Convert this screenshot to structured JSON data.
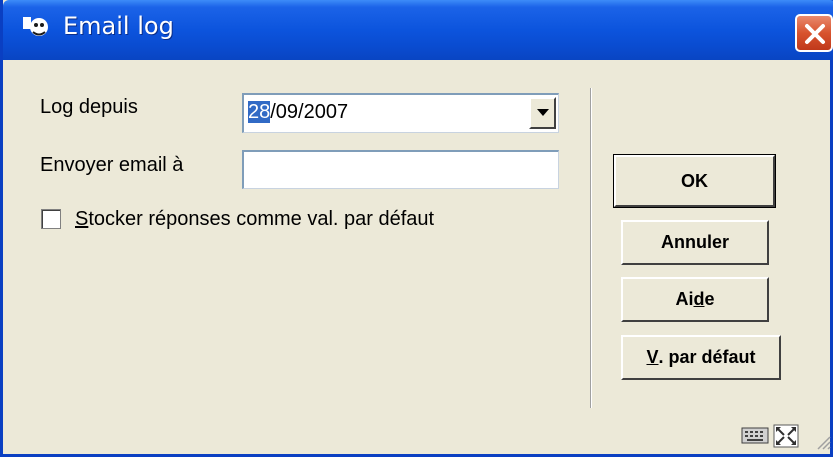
{
  "window": {
    "title": "Email log",
    "close_icon": "close-icon",
    "app_icon": "app-icon"
  },
  "form": {
    "log_since_label": "Log depuis",
    "log_since_value_selected": "28",
    "log_since_value_rest": "/09/2007",
    "send_email_label": "Envoyer email à",
    "send_email_value": "",
    "store_checkbox_accel": "S",
    "store_checkbox_rest": "tocker réponses comme val. par défaut",
    "store_checked": false
  },
  "buttons": {
    "ok": "OK",
    "cancel": "Annuler",
    "help_pre": "Ai",
    "help_accel": "d",
    "help_post": "e",
    "defaults_accel": "V",
    "defaults_rest": ". par défaut"
  },
  "status_icons": [
    "keyboard-icon",
    "resize-icon"
  ],
  "colors": {
    "title_bar": "#0A4BCF",
    "selection": "#316AC5",
    "dialog_bg": "#ECE9D8",
    "close_button": "#D8532E"
  }
}
